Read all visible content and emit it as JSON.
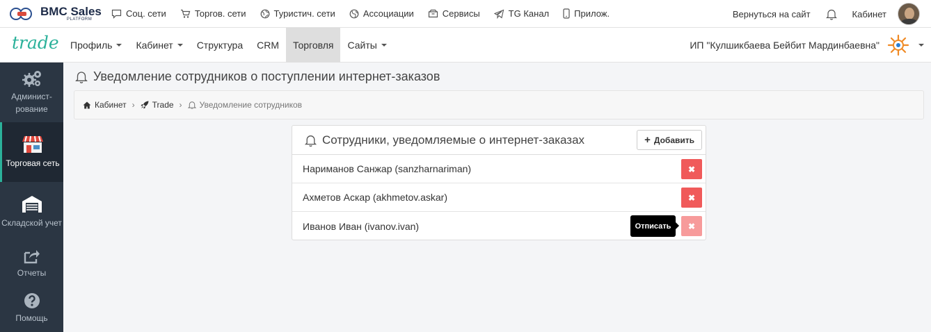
{
  "topbar": {
    "logo_main": "BMC Sales",
    "logo_sub": "PLATFORM",
    "nav": [
      {
        "label": "Соц. сети",
        "icon": "chat-icon"
      },
      {
        "label": "Торгов. сети",
        "icon": "cart-icon"
      },
      {
        "label": "Туристич. сети",
        "icon": "globe-icon"
      },
      {
        "label": "Ассоциации",
        "icon": "globe-alt-icon"
      },
      {
        "label": "Сервисы",
        "icon": "box-icon"
      },
      {
        "label": "TG Канал",
        "icon": "telegram-icon"
      },
      {
        "label": "Прилож.",
        "icon": "phone-icon"
      }
    ],
    "back_link": "Вернуться на сайт",
    "cabinet_link": "Кабинет"
  },
  "secbar": {
    "logo": "trade",
    "nav": [
      {
        "label": "Профиль",
        "dropdown": true
      },
      {
        "label": "Кабинет",
        "dropdown": true
      },
      {
        "label": "Структура",
        "dropdown": false
      },
      {
        "label": "CRM",
        "dropdown": false
      },
      {
        "label": "Торговля",
        "dropdown": false,
        "active": true
      },
      {
        "label": "Сайты",
        "dropdown": true
      }
    ],
    "company": "ИП \"Кулшикбаева Бейбит Мардинбаевна\""
  },
  "sidebar": {
    "items": [
      {
        "label": "Админист-рование",
        "icon": "gears-icon"
      },
      {
        "label": "Торговая сеть",
        "icon": "shop-icon",
        "active": true
      },
      {
        "label": "Складской учет",
        "icon": "warehouse-icon"
      },
      {
        "label": "Отчеты",
        "icon": "share-icon"
      },
      {
        "label": "Помощь",
        "icon": "help-icon"
      }
    ]
  },
  "main": {
    "page_title": "Уведомление сотрудников о поступлении интернет-заказов",
    "breadcrumb": [
      {
        "label": "Кабинет",
        "icon": "home-icon"
      },
      {
        "label": "Trade",
        "icon": "rocket-icon"
      },
      {
        "label": "Уведомление сотрудников",
        "icon": "bell-icon"
      }
    ],
    "panel": {
      "title": "Сотрудники, уведомляемые о интернет-заказах",
      "add_label": "Добавить",
      "employees": [
        {
          "name": "Нариманов Санжар (sanzharnariman)"
        },
        {
          "name": "Ахметов Аскар (akhmetov.askar)"
        },
        {
          "name": "Иванов Иван (ivanov.ivan)"
        }
      ],
      "delete_glyph": "✖",
      "tooltip": "Отписать"
    }
  },
  "colors": {
    "accent": "#2bb19a",
    "sidebar_bg": "#2b3643",
    "danger": "#f05a5a"
  }
}
